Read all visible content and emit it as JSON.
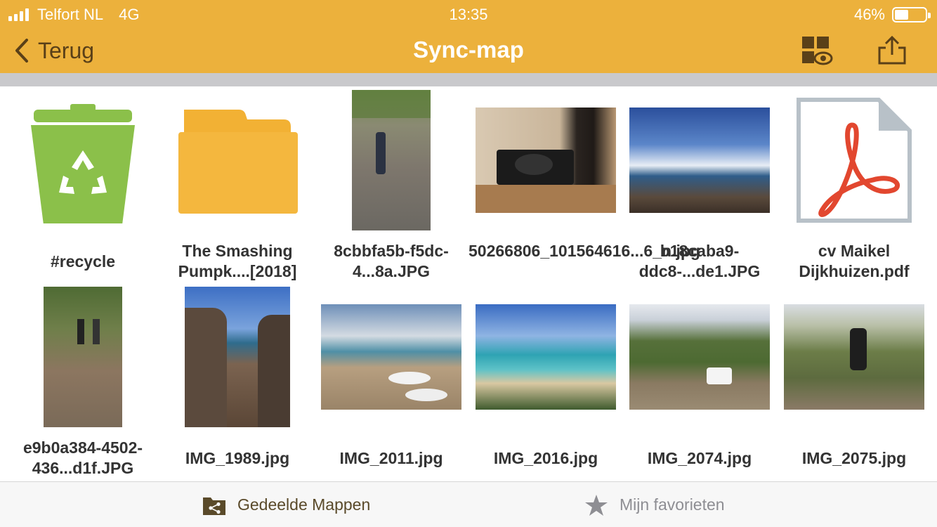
{
  "status_bar": {
    "carrier": "Telfort NL",
    "network": "4G",
    "time": "13:35",
    "battery": "46%",
    "battery_level": 0.46
  },
  "nav": {
    "back_label": "Terug",
    "title": "Sync-map",
    "view_icon": "grid-eye-icon",
    "share_icon": "share-icon"
  },
  "files": [
    {
      "name": "#recycle",
      "kind": "recycle-bin"
    },
    {
      "name": "The Smashing Pumpk....[2018]",
      "kind": "folder"
    },
    {
      "name": "8cbbfa5b-f5dc-4...8a.JPG",
      "kind": "photo"
    },
    {
      "name": "50266806_101564616...6_n.jpg",
      "kind": "photo"
    },
    {
      "name": "b18caba9-ddc8-...de1.JPG",
      "kind": "photo"
    },
    {
      "name": "cv Maikel Dijkhuizen.pdf",
      "kind": "pdf"
    },
    {
      "name": "e9b0a384-4502-436...d1f.JPG",
      "kind": "photo"
    },
    {
      "name": "IMG_1989.jpg",
      "kind": "photo"
    },
    {
      "name": "IMG_2011.jpg",
      "kind": "photo"
    },
    {
      "name": "IMG_2016.jpg",
      "kind": "photo"
    },
    {
      "name": "IMG_2074.jpg",
      "kind": "photo"
    },
    {
      "name": "IMG_2075.jpg",
      "kind": "photo"
    }
  ],
  "tabs": {
    "shared_label": "Gedeelde Mappen",
    "shared_icon": "shared-folder-icon",
    "favorites_label": "Mijn favorieten",
    "favorites_icon": "star-icon"
  },
  "colors": {
    "header": "#ecb13c",
    "accent_dark": "#5a4018",
    "recycle_green": "#8bc04a",
    "folder_orange": "#f2b134",
    "pdf_red": "#e2472f"
  }
}
